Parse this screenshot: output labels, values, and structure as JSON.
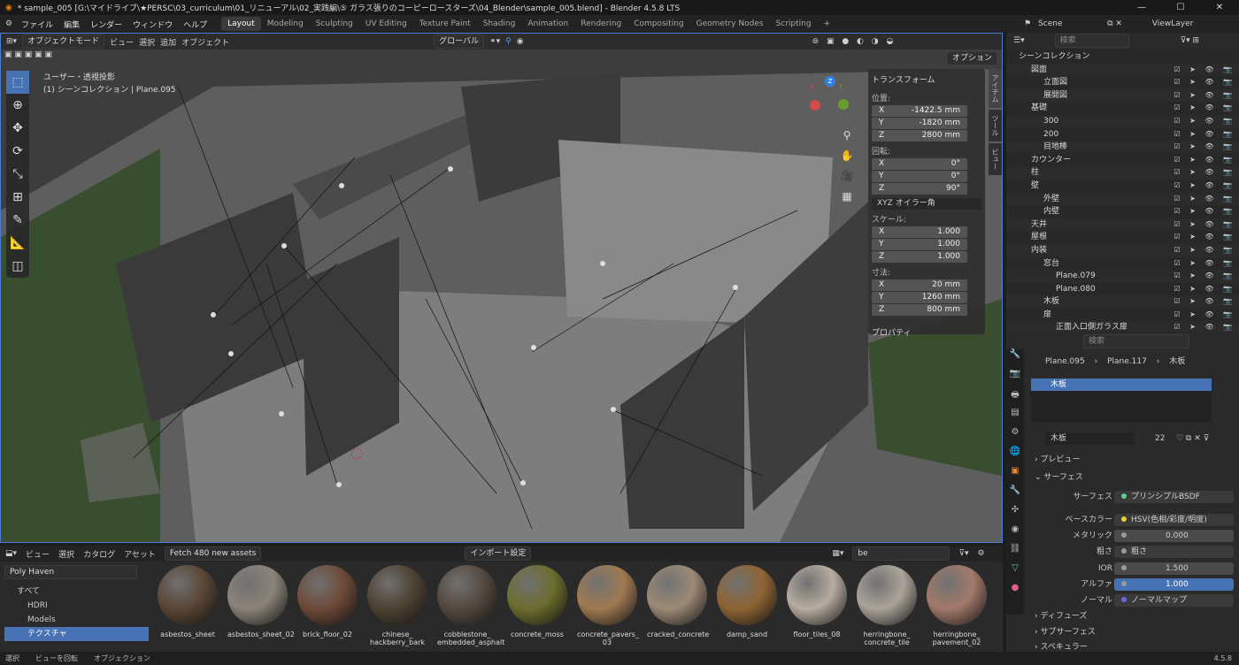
{
  "window": {
    "title": "* sample_005 [G:\\マイドライブ\\★PERSC\\03_curriculum\\01_リニューアル\\02_実践編\\⑤ ガラス張りのコーピーロースターズ\\04_Blender\\sample_005.blend] - Blender 4.5.8 LTS"
  },
  "menu": [
    "ファイル",
    "編集",
    "レンダー",
    "ウィンドウ",
    "ヘルプ"
  ],
  "workspaces": [
    "Layout",
    "Modeling",
    "Sculpting",
    "UV Editing",
    "Texture Paint",
    "Shading",
    "Animation",
    "Rendering",
    "Compositing",
    "Geometry Nodes",
    "Scripting"
  ],
  "viewport": {
    "mode": "オブジェクトモード",
    "menus": [
      "ビュー",
      "選択",
      "追加",
      "オブジェクト"
    ],
    "transform_orientation": "グローバル",
    "options": "オプション",
    "view_name": "ユーザー・透視投影",
    "context": "(1) シーンコレクション | Plane.095",
    "gizmo": {
      "x": "X",
      "y": "Y",
      "z": "Z"
    }
  },
  "n_panel": {
    "title": "トランスフォーム",
    "location_label": "位置:",
    "location": [
      {
        "axis": "X",
        "value": "-1422.5 mm"
      },
      {
        "axis": "Y",
        "value": "-1820 mm"
      },
      {
        "axis": "Z",
        "value": "2800 mm"
      }
    ],
    "rotation_label": "回転:",
    "rotation": [
      {
        "axis": "X",
        "value": "0°"
      },
      {
        "axis": "Y",
        "value": "0°"
      },
      {
        "axis": "Z",
        "value": "90°"
      }
    ],
    "rotation_mode": "XYZ オイラー角",
    "scale_label": "スケール:",
    "scale": [
      {
        "axis": "X",
        "value": "1.000"
      },
      {
        "axis": "Y",
        "value": "1.000"
      },
      {
        "axis": "Z",
        "value": "1.000"
      }
    ],
    "dimensions_label": "寸法:",
    "dimensions": [
      {
        "axis": "X",
        "value": "20 mm"
      },
      {
        "axis": "Y",
        "value": "1260 mm"
      },
      {
        "axis": "Z",
        "value": "800 mm"
      }
    ],
    "properties": "プロパティ",
    "tabs": [
      "アイテム",
      "ツール",
      "ビュー"
    ]
  },
  "asset_browser": {
    "menus": [
      "ビュー",
      "選択",
      "カタログ",
      "アセット"
    ],
    "fetch_button": "Fetch 480 new assets",
    "import_setting": "インポート設定",
    "search": "be",
    "library": "Poly Haven",
    "tree": [
      "すべて",
      "HDRI",
      "Models",
      "テクスチャ"
    ],
    "assets": [
      {
        "name": "asbestos_sheet",
        "color": "#5a4636"
      },
      {
        "name": "asbestos_sheet_02",
        "color": "#8a8378"
      },
      {
        "name": "brick_floor_02",
        "color": "#6e4a38"
      },
      {
        "name": "chinese_ hackberry_bark",
        "color": "#4e4232"
      },
      {
        "name": "cobblestone_ embedded_asphalt",
        "color": "#55493f"
      },
      {
        "name": "concrete_moss",
        "color": "#6c6d2e"
      },
      {
        "name": "concrete_pavers_ 03",
        "color": "#a07a52"
      },
      {
        "name": "cracked_concrete",
        "color": "#9c8a76"
      },
      {
        "name": "damp_sand",
        "color": "#8e6434"
      },
      {
        "name": "floor_tiles_08",
        "color": "#b7aca0"
      },
      {
        "name": "herringbone_ concrete_tile",
        "color": "#aaa49a"
      },
      {
        "name": "herringbone_ pavement_02",
        "color": "#a2796a"
      }
    ]
  },
  "statusbar": {
    "select": "選択",
    "rotate": "ビューを回転",
    "options": "オブジェクション",
    "version": "4.5.8"
  },
  "outliner": {
    "scene": "Scene",
    "view_layer": "ViewLayer",
    "search_placeholder": "検索",
    "rows": [
      {
        "name": "シーンコレクション",
        "depth": 0
      },
      {
        "name": "図面",
        "depth": 1
      },
      {
        "name": "立面図",
        "depth": 2
      },
      {
        "name": "展開図",
        "depth": 2
      },
      {
        "name": "基礎",
        "depth": 1
      },
      {
        "name": "300",
        "depth": 2
      },
      {
        "name": "200",
        "depth": 2
      },
      {
        "name": "目地棒",
        "depth": 2
      },
      {
        "name": "カウンター",
        "depth": 1
      },
      {
        "name": "柱",
        "depth": 1
      },
      {
        "name": "壁",
        "depth": 1
      },
      {
        "name": "外壁",
        "depth": 2
      },
      {
        "name": "内壁",
        "depth": 2
      },
      {
        "name": "天井",
        "depth": 1
      },
      {
        "name": "屋根",
        "depth": 1
      },
      {
        "name": "内装",
        "depth": 1
      },
      {
        "name": "窓台",
        "depth": 2
      },
      {
        "name": "Plane.079",
        "depth": 3
      },
      {
        "name": "Plane.080",
        "depth": 3
      },
      {
        "name": "木板",
        "depth": 2
      },
      {
        "name": "扉",
        "depth": 2
      },
      {
        "name": "正面入口側ガラス扉",
        "depth": 3
      }
    ]
  },
  "properties": {
    "search_placeholder": "検索",
    "breadcrumb": [
      "Plane.095",
      "Plane.117",
      "木板"
    ],
    "material_slot": "木板",
    "material_name": "木板",
    "users": "22",
    "preview": "プレビュー",
    "surface_panel": "サーフェス",
    "surface_label": "サーフェス",
    "surface_value": "プリンシプルBSDF",
    "base_color_label": "ベースカラー",
    "base_color_value": "HSV(色相/彩度/明度)",
    "metallic_label": "メタリック",
    "metallic_value": "0.000",
    "roughness_label": "粗さ",
    "roughness_value": "粗さ",
    "ior_label": "IOR",
    "ior_value": "1.500",
    "alpha_label": "アルファ",
    "alpha_value": "1.000",
    "normal_label": "ノーマル",
    "normal_value": "ノーマルマップ",
    "diffuse": "ディフューズ",
    "subsurface": "サブサーフェス",
    "specular": "スペキュラー"
  }
}
